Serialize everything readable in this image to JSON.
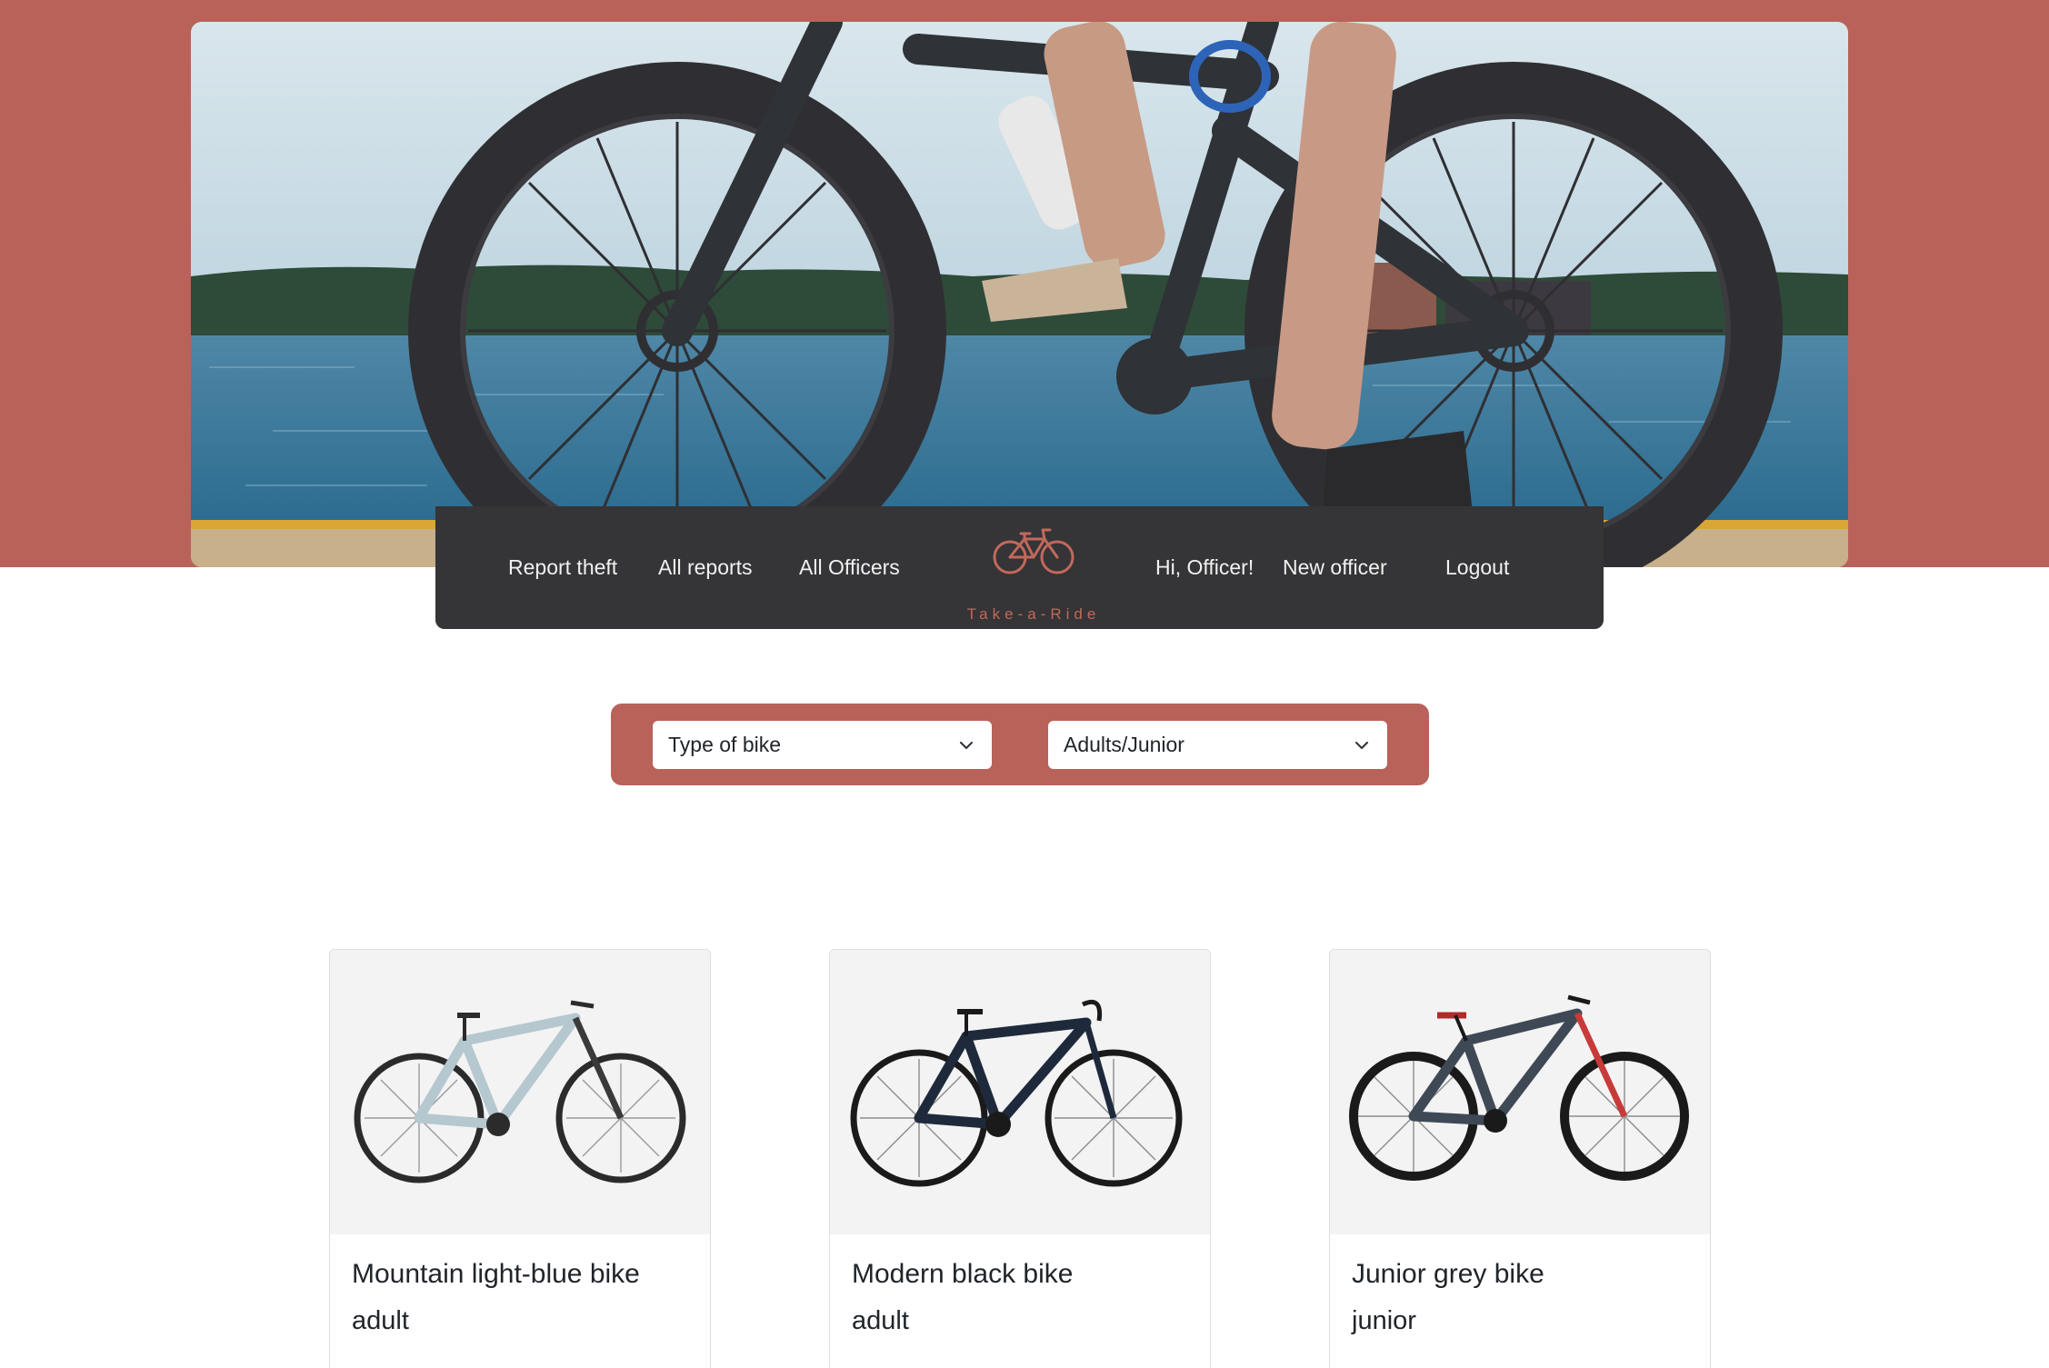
{
  "colors": {
    "brand": "#b8625a",
    "navbar": "#353436",
    "logo": "#c2695c",
    "card_image_bg": "#f3f3f3"
  },
  "navbar": {
    "left_links": [
      "Report theft",
      "All reports",
      "All Officers"
    ],
    "logo_text": "Take-a-Ride",
    "greeting": "Hi, Officer!",
    "right_links": [
      "New officer",
      "Logout"
    ]
  },
  "filters": {
    "type_of_bike": "Type of bike",
    "age_group": "Adults/Junior"
  },
  "bikes": [
    {
      "title": "Mountain light-blue bike",
      "category": "adult",
      "frame_color": "#b5c7cf"
    },
    {
      "title": "Modern black bike",
      "category": "adult",
      "frame_color": "#1e2a3c"
    },
    {
      "title": "Junior grey bike",
      "category": "junior",
      "frame_color": "#3f4956"
    }
  ]
}
